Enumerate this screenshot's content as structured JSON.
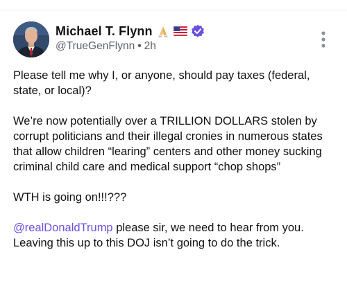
{
  "author": {
    "display_name": "Michael T. Flynn",
    "name_emojis": [
      "praying-hands-icon",
      "us-flag-icon"
    ],
    "handle": "@TrueGenFlynn",
    "time_separator": "•",
    "timestamp": "2h",
    "verified": true
  },
  "colors": {
    "verified_badge": "#6b4fe0",
    "mention_link": "#6b4fe0",
    "secondary_text": "#5a5f6b"
  },
  "post": {
    "para1": "Please tell me why I, or anyone, should pay taxes (federal, state, or local)?",
    "para2": "We’re now potentially over a TRILLION DOLLARS stolen by corrupt politicians and their illegal cronies in numerous states that allow children “learing” centers and other money sucking criminal child care and medical support “chop shops”",
    "para3": "WTH is going on!!!???",
    "mention": "@realDonaldTrump",
    "para4_rest": " please sir, we need to hear from you. Leaving this up to this DOJ isn’t going to do the trick."
  },
  "icons": {
    "more": "more-vertical-icon",
    "verified": "verified-badge-icon"
  }
}
